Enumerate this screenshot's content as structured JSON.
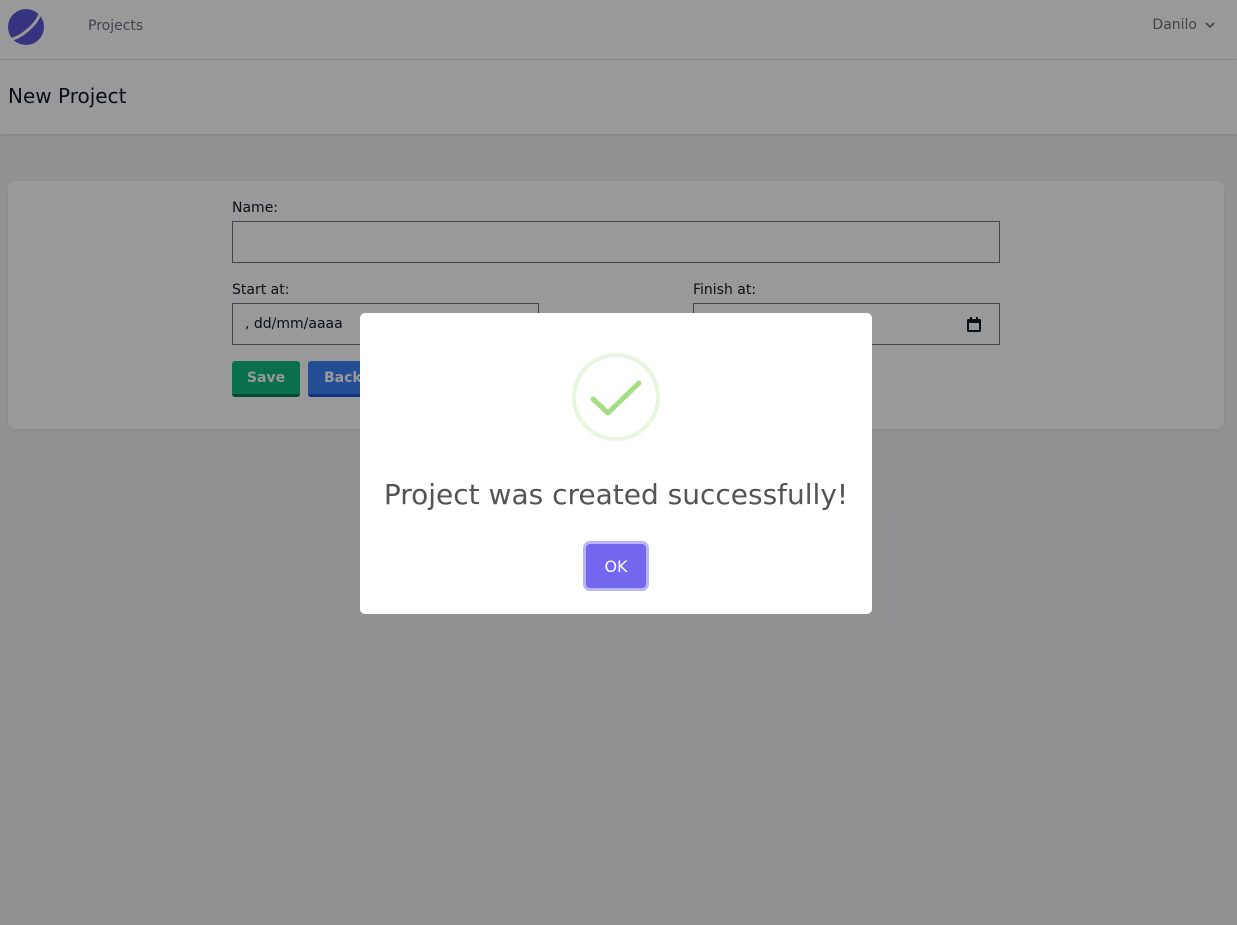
{
  "nav": {
    "brand_icon": "app-logo",
    "projects_link": "Projects",
    "user_name": "Danilo",
    "user_menu_icon": "chevron-down-icon"
  },
  "header": {
    "title": "New Project"
  },
  "form": {
    "name_label": "Name:",
    "name_value": "",
    "start_label": "Start at:",
    "start_value": ", dd/mm/aaaa",
    "finish_label": "Finish at:",
    "finish_value": "",
    "save_label": "Save",
    "back_label": "Back"
  },
  "modal": {
    "icon": "success-check-icon",
    "message": "Project was created successfully!",
    "ok_label": "OK"
  },
  "colors": {
    "save": "#10b981",
    "back": "#3b82f6",
    "ok": "#7367f0",
    "success": "#a5dc86"
  }
}
